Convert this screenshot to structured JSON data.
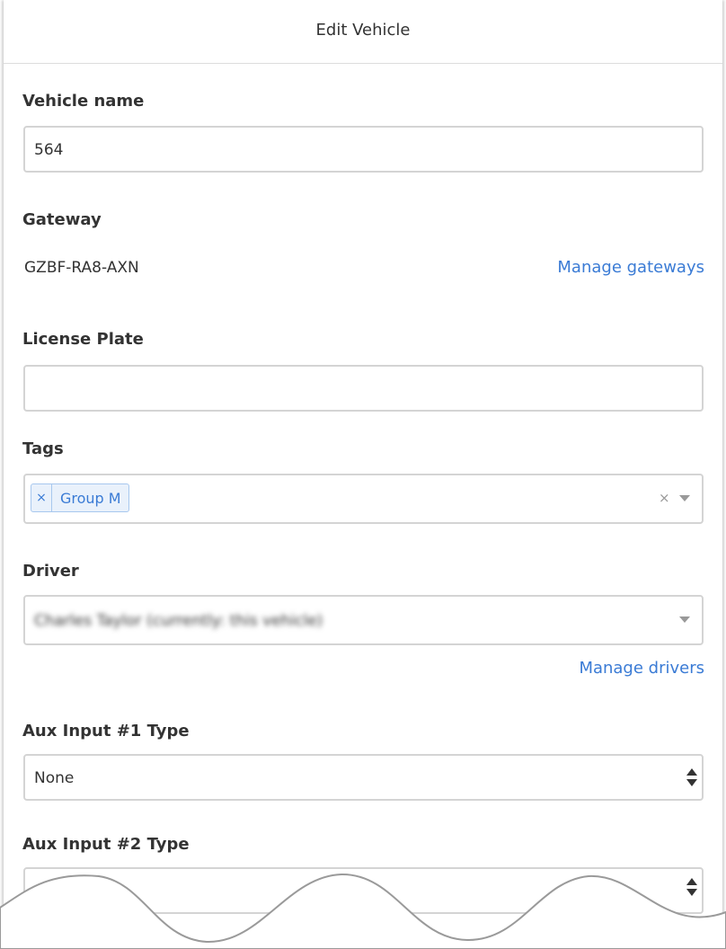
{
  "header": {
    "title": "Edit Vehicle"
  },
  "vehicle_name": {
    "label": "Vehicle name",
    "value": "564"
  },
  "gateway": {
    "label": "Gateway",
    "value": "GZBF-RA8-AXN",
    "manage_link": "Manage gateways"
  },
  "license_plate": {
    "label": "License Plate",
    "value": ""
  },
  "tags": {
    "label": "Tags",
    "items": [
      {
        "remove": "×",
        "name": "Group M"
      }
    ],
    "clear": "×"
  },
  "driver": {
    "label": "Driver",
    "value": "Charles Taylor (currently: this vehicle)",
    "manage_link": "Manage drivers"
  },
  "aux1": {
    "label": "Aux Input #1 Type",
    "value": "None"
  },
  "aux2": {
    "label": "Aux Input #2 Type",
    "value": ""
  }
}
